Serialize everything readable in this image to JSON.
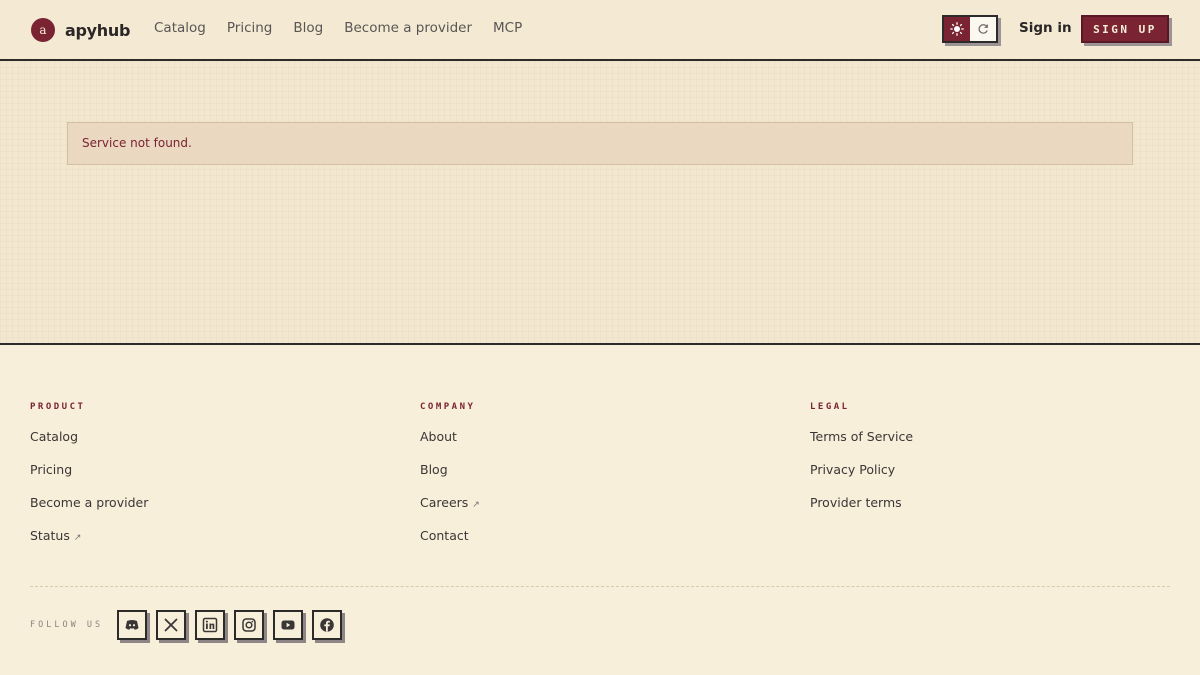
{
  "brand": {
    "logo_letter": "a",
    "name": "apyhub"
  },
  "nav": {
    "items": [
      {
        "label": "Catalog"
      },
      {
        "label": "Pricing"
      },
      {
        "label": "Blog"
      },
      {
        "label": "Become a provider"
      },
      {
        "label": "MCP"
      }
    ]
  },
  "header": {
    "signin_label": "Sign in",
    "signup_label": "SIGN UP"
  },
  "alert": {
    "message": "Service not found."
  },
  "footer": {
    "product": {
      "title": "PRODUCT",
      "links": [
        {
          "label": "Catalog"
        },
        {
          "label": "Pricing"
        },
        {
          "label": "Become a provider"
        },
        {
          "label": "Status",
          "external": true
        }
      ]
    },
    "company": {
      "title": "COMPANY",
      "links": [
        {
          "label": "About"
        },
        {
          "label": "Blog"
        },
        {
          "label": "Careers",
          "external": true
        },
        {
          "label": "Contact"
        }
      ]
    },
    "legal": {
      "title": "LEGAL",
      "links": [
        {
          "label": "Terms of Service"
        },
        {
          "label": "Privacy Policy"
        },
        {
          "label": "Provider terms"
        }
      ]
    },
    "follow_label": "FOLLOW US",
    "socials": [
      "discord-icon",
      "x-icon",
      "linkedin-icon",
      "instagram-icon",
      "youtube-icon",
      "facebook-icon"
    ]
  },
  "colors": {
    "accent": "#7a2333",
    "background": "#f7efd9",
    "border": "#2d2a2a"
  }
}
